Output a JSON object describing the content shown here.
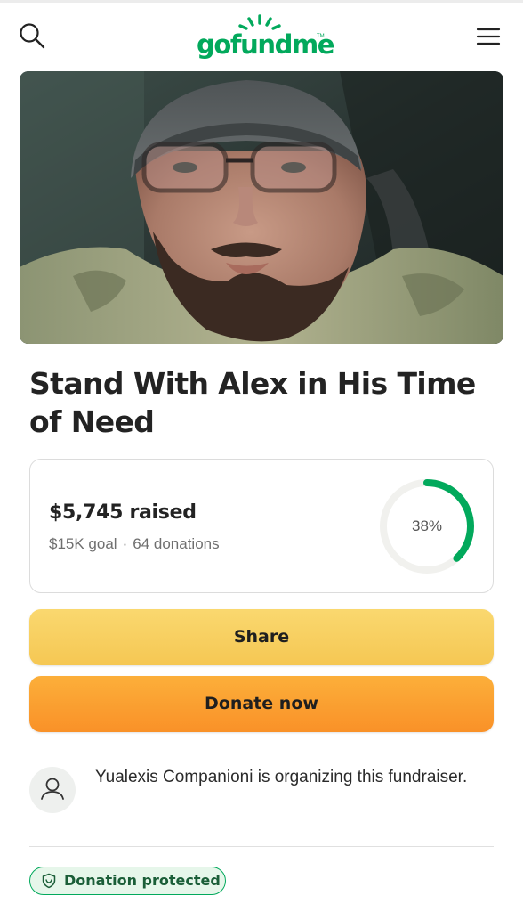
{
  "header": {
    "logo_text": "gofundme",
    "logo_tm": "TM",
    "search_icon": "search-icon",
    "menu_icon": "hamburger-menu-icon",
    "brand_color": "#02a95c"
  },
  "fundraiser": {
    "title": "Stand With Alex in His Time of Need",
    "hero_image": "photo of a bearded man wearing glasses and a gray beanie"
  },
  "stats": {
    "raised": "$5,745 raised",
    "goal": "$15K goal",
    "separator": "·",
    "donations": "64 donations",
    "progress_label": "38%",
    "progress_fraction": 0.38,
    "progress_color": "#02a95c"
  },
  "actions": {
    "share_label": "Share",
    "donate_label": "Donate now"
  },
  "organizer": {
    "avatar_icon": "user-icon",
    "text": "Yualexis Companioni is organizing this fundraiser."
  },
  "badge": {
    "icon": "shield-icon",
    "label": "Donation protected"
  }
}
